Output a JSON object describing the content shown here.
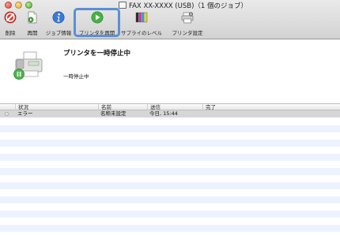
{
  "window": {
    "title": "FAX XX-XXXX (USB)（1 個のジョブ）"
  },
  "toolbar": {
    "delete_label": "削除",
    "resume_job_label": "再開",
    "job_info_label": "ジョブ情報",
    "resume_printer_label": "プリンタを再開",
    "supply_levels_label": "サプライのレベル",
    "printer_settings_label": "プリンタ設定"
  },
  "status": {
    "title": "プリンタを一時停止中",
    "subtitle": "一時停止中"
  },
  "table": {
    "columns": [
      "状況",
      "名前",
      "送信",
      "完了"
    ],
    "rows": [
      {
        "status": "エラー",
        "name": "名称未設定",
        "sent": "今日, 15:44",
        "completed": ""
      }
    ]
  },
  "colors": {
    "highlight_border": "#5a8fd6",
    "selected_row": "#d6d6d6",
    "stripe": "#edf3fe"
  }
}
